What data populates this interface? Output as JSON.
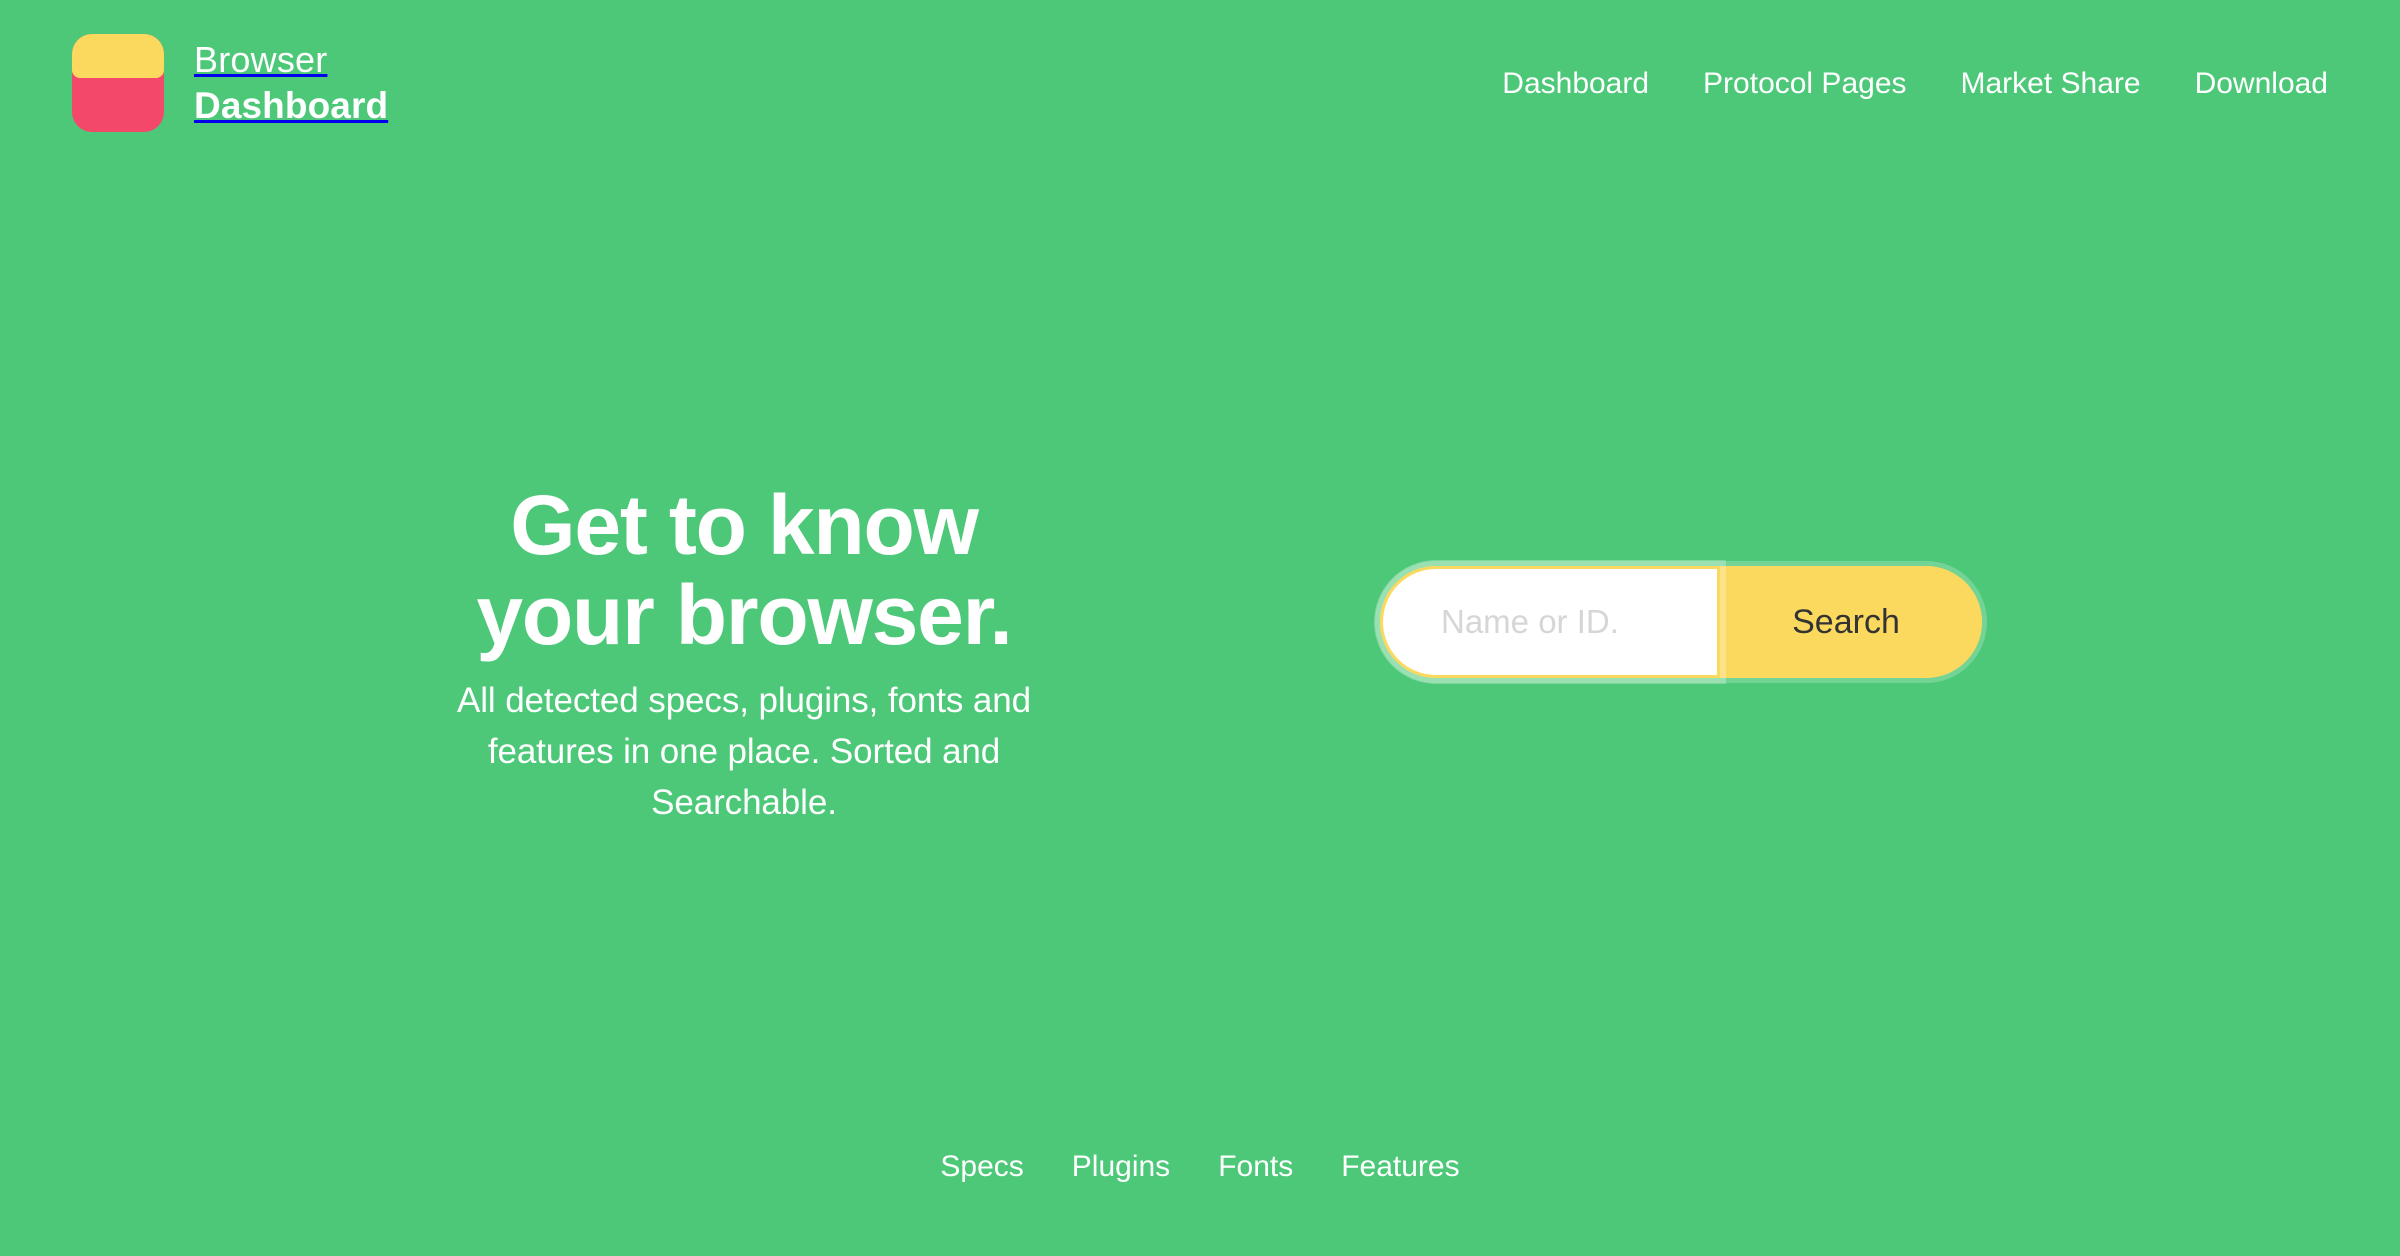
{
  "theme": {
    "background": "#4cc878",
    "accent_yellow": "#fbd95e",
    "accent_pink": "#f4486b",
    "text_on_green": "#ffffff",
    "button_text": "#333333",
    "placeholder_color": "#d6d6d6"
  },
  "header": {
    "logo": {
      "icon": "browser-window-icon",
      "body_color": "#f4486b",
      "bar_color": "#fbd95e"
    },
    "brand_line1": "Browser",
    "brand_line2": "Dashboard",
    "nav": [
      {
        "label": "Dashboard"
      },
      {
        "label": "Protocol Pages"
      },
      {
        "label": "Market Share"
      },
      {
        "label": "Download"
      }
    ]
  },
  "hero": {
    "title_line1": "Get to know",
    "title_line2": "your browser.",
    "subtitle": "All detected specs, plugins, fonts and features in one place. Sorted and Searchable.",
    "search": {
      "placeholder": "Name or ID.",
      "value": "",
      "button_label": "Search"
    }
  },
  "footer": {
    "links": [
      {
        "label": "Specs"
      },
      {
        "label": "Plugins"
      },
      {
        "label": "Fonts"
      },
      {
        "label": "Features"
      }
    ]
  }
}
